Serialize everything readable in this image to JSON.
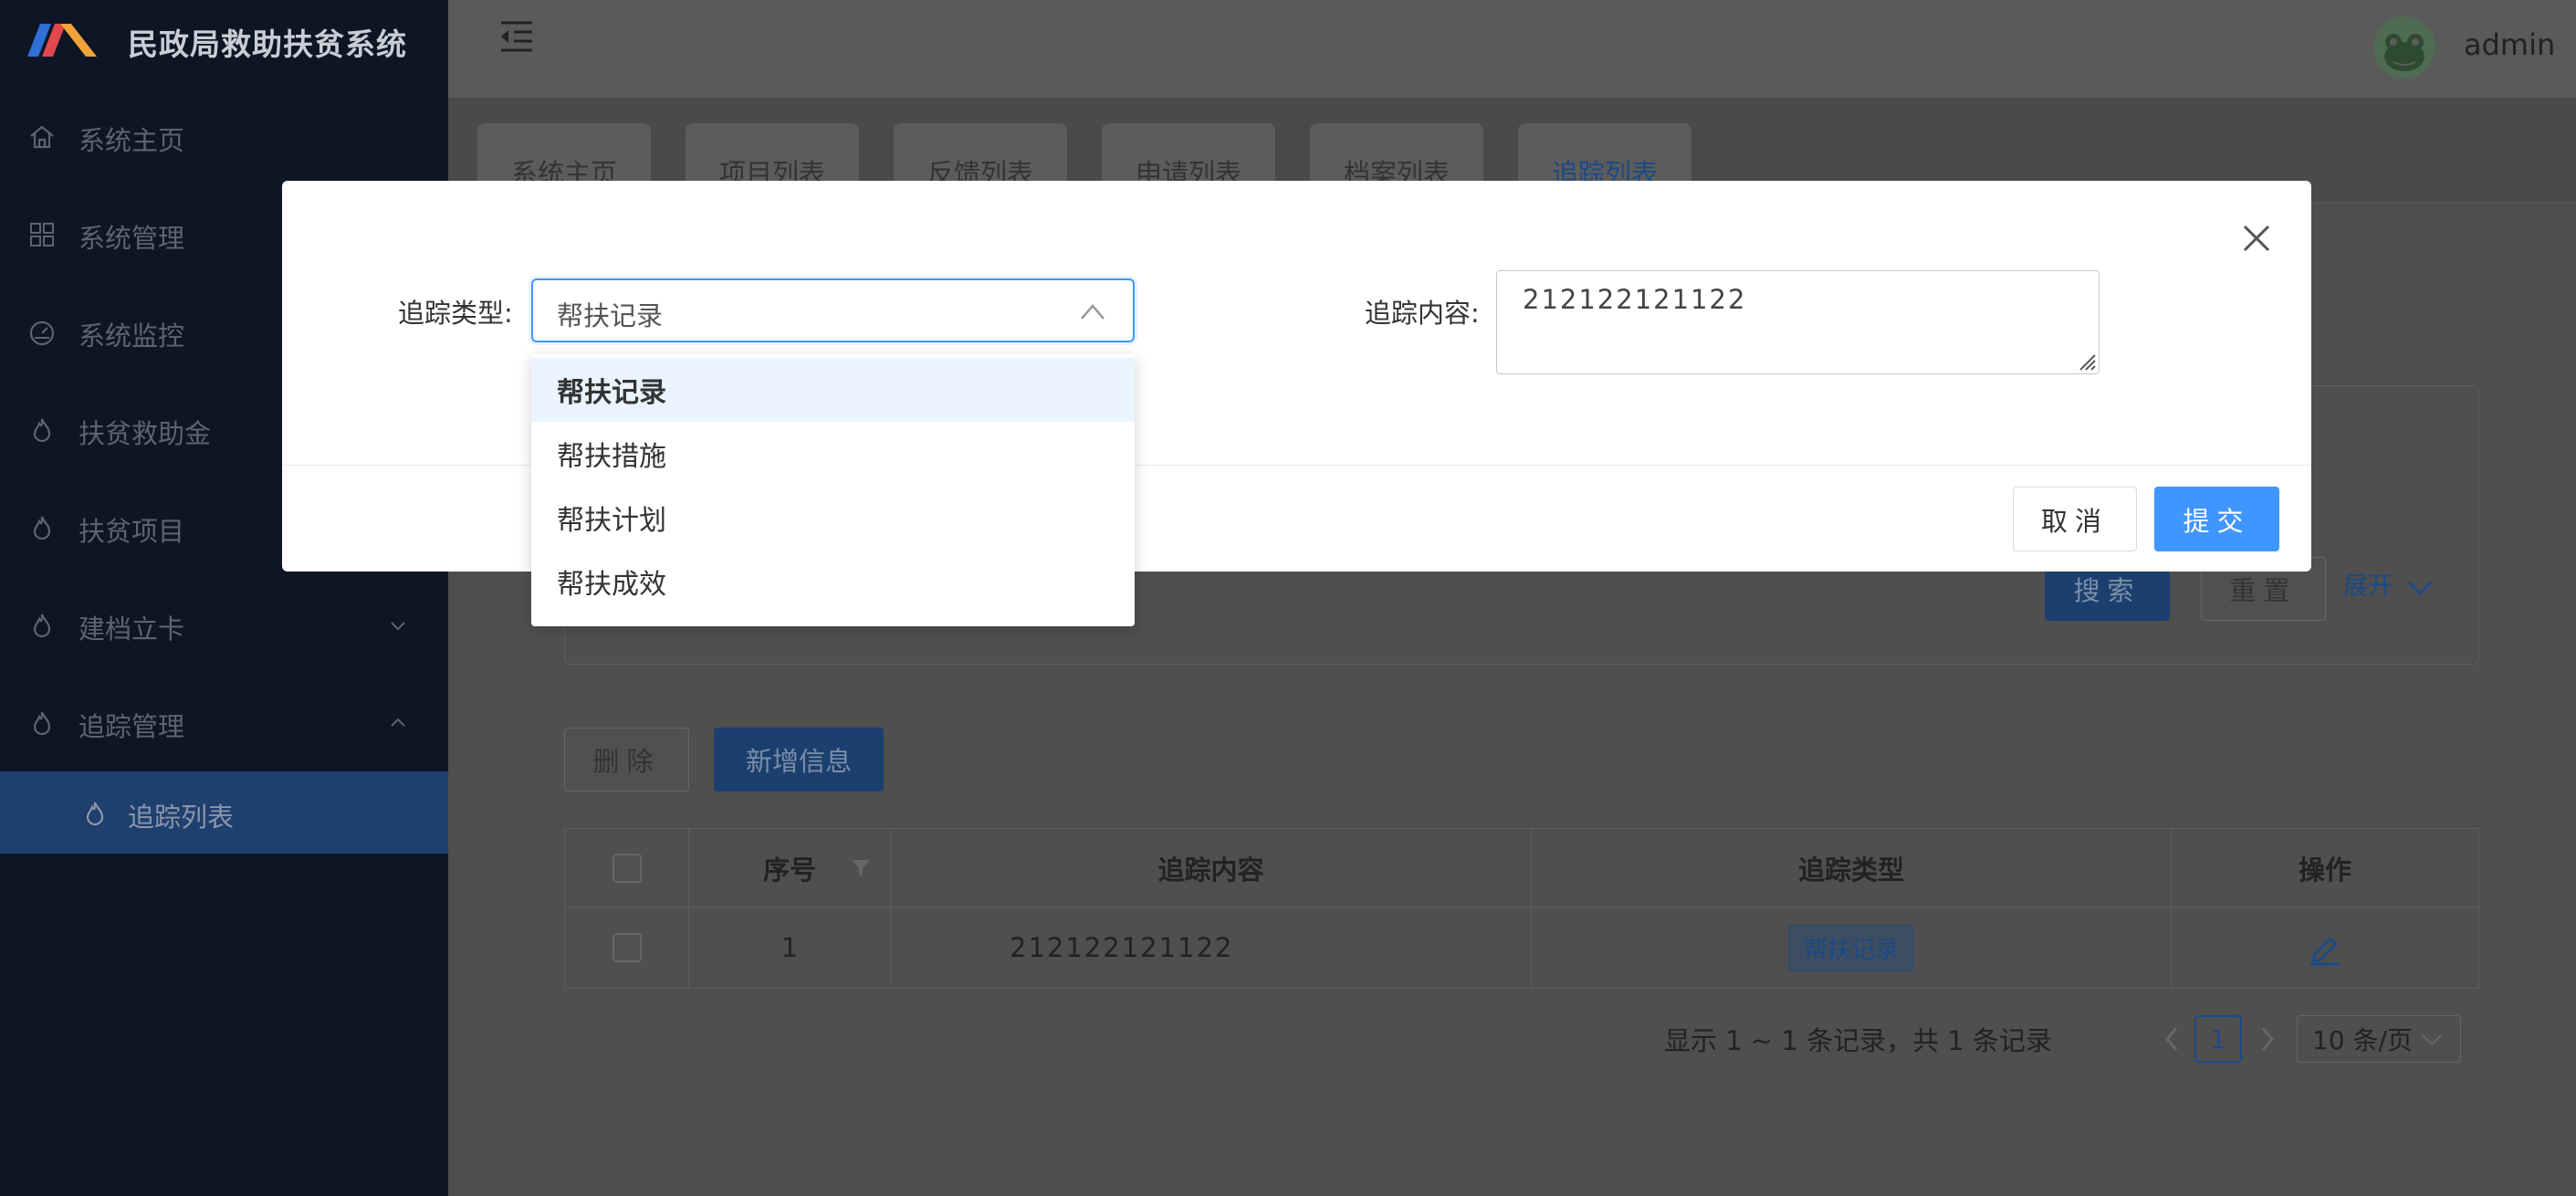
{
  "app": {
    "title": "民政局救助扶贫系统",
    "username": "admin"
  },
  "sidebar": {
    "items": [
      {
        "label": "系统主页",
        "icon": "home-icon"
      },
      {
        "label": "系统管理",
        "icon": "grid-icon"
      },
      {
        "label": "系统监控",
        "icon": "gauge-icon"
      },
      {
        "label": "扶贫救助金",
        "icon": "flame-icon"
      },
      {
        "label": "扶贫项目",
        "icon": "flame-icon"
      },
      {
        "label": "建档立卡",
        "icon": "flame-icon"
      },
      {
        "label": "追踪管理",
        "icon": "flame-icon"
      }
    ],
    "subitem": {
      "label": "追踪列表",
      "icon": "flame-icon"
    }
  },
  "tabs": [
    "系统主页",
    "项目列表",
    "反馈列表",
    "申请列表",
    "档案列表",
    "追踪列表"
  ],
  "active_tab": "追踪列表",
  "toolbar": {
    "search_label": "搜索",
    "reset_label": "重置",
    "expand_label": "展开",
    "delete_label": "删除",
    "add_label": "新增信息"
  },
  "table": {
    "headers": [
      "序号",
      "追踪内容",
      "追踪类型",
      "操作"
    ],
    "rows": [
      {
        "index": "1",
        "content": "212122121122",
        "type": "帮扶记录"
      }
    ]
  },
  "pagination": {
    "summary": "显示 1 ~ 1 条记录，共 1 条记录",
    "current_page": "1",
    "page_size": "10 条/页"
  },
  "modal": {
    "type_label": "追踪类型:",
    "type_value": "帮扶记录",
    "content_label": "追踪内容:",
    "content_value": "212122121122",
    "cancel_label": "取消",
    "submit_label": "提交"
  },
  "dropdown": {
    "options": [
      "帮扶记录",
      "帮扶措施",
      "帮扶计划",
      "帮扶成效"
    ],
    "selected": "帮扶记录"
  },
  "colors": {
    "sidebar_bg": "#0e1626",
    "primary": "#4096ff",
    "active_menu": "#1f3f6e"
  }
}
